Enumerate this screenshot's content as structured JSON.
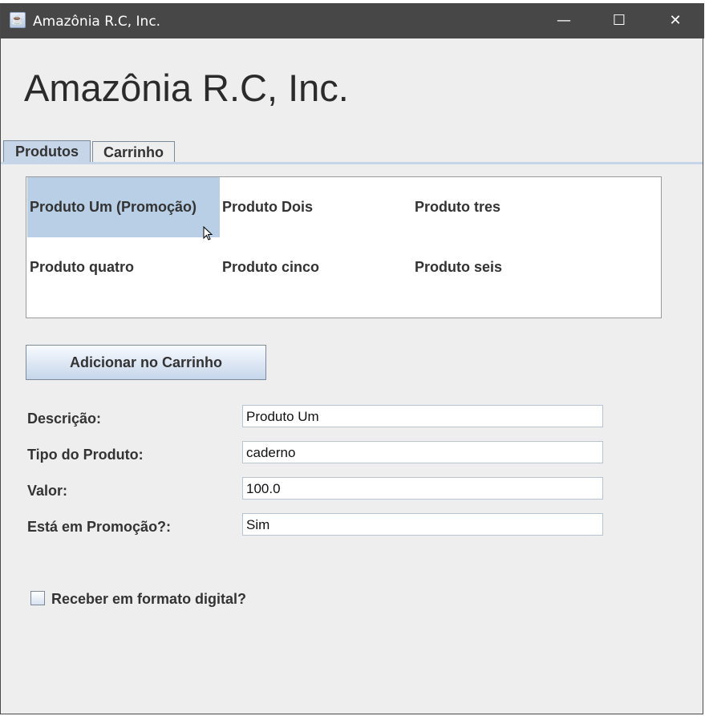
{
  "window": {
    "title": "Amazônia R.C, Inc.",
    "minimize_glyph": "—",
    "maximize_glyph": "☐",
    "close_glyph": "✕"
  },
  "heading": "Amazônia R.C, Inc.",
  "tabs": [
    {
      "label": "Produtos",
      "active": true
    },
    {
      "label": "Carrinho",
      "active": false
    }
  ],
  "products": [
    {
      "label": "Produto Um (Promoção)",
      "selected": true
    },
    {
      "label": "Produto Dois",
      "selected": false
    },
    {
      "label": "Produto tres",
      "selected": false
    },
    {
      "label": "Produto quatro",
      "selected": false
    },
    {
      "label": "Produto cinco",
      "selected": false
    },
    {
      "label": "Produto seis",
      "selected": false
    }
  ],
  "add_button_label": "Adicionar no Carrinho",
  "form": {
    "descricao_label": "Descrição:",
    "descricao_value": "Produto Um",
    "tipo_label": "Tipo do Produto:",
    "tipo_value": "caderno",
    "valor_label": "Valor:",
    "valor_value": "100.0",
    "promocao_label": "Está em Promoção?:",
    "promocao_value": "Sim"
  },
  "digital_checkbox": {
    "label": "Receber em formato digital?",
    "checked": false
  },
  "colors": {
    "titlebar": "#474747",
    "selection": "#b8cfe5",
    "window_bg": "#eeeeee"
  }
}
